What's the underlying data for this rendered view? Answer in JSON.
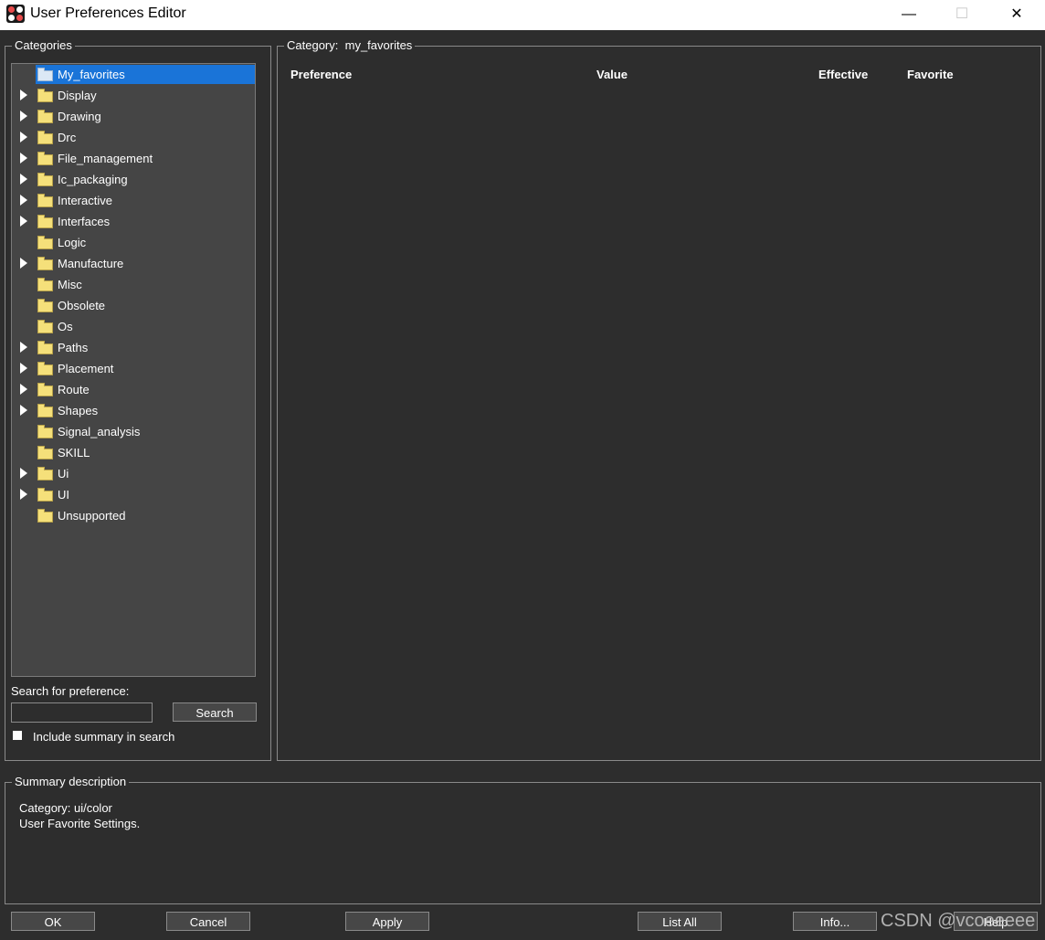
{
  "window": {
    "title": "User Preferences Editor",
    "minimize_glyph": "—",
    "maximize_glyph": "☐",
    "close_glyph": "✕"
  },
  "categories": {
    "group_label": "Categories",
    "items": [
      {
        "label": "My_favorites",
        "expandable": false,
        "selected": true
      },
      {
        "label": "Display",
        "expandable": true
      },
      {
        "label": "Drawing",
        "expandable": true
      },
      {
        "label": "Drc",
        "expandable": true
      },
      {
        "label": "File_management",
        "expandable": true
      },
      {
        "label": "Ic_packaging",
        "expandable": true
      },
      {
        "label": "Interactive",
        "expandable": true
      },
      {
        "label": "Interfaces",
        "expandable": true
      },
      {
        "label": "Logic",
        "expandable": false
      },
      {
        "label": "Manufacture",
        "expandable": true
      },
      {
        "label": "Misc",
        "expandable": false
      },
      {
        "label": "Obsolete",
        "expandable": false
      },
      {
        "label": "Os",
        "expandable": false
      },
      {
        "label": "Paths",
        "expandable": true
      },
      {
        "label": "Placement",
        "expandable": true
      },
      {
        "label": "Route",
        "expandable": true
      },
      {
        "label": "Shapes",
        "expandable": true
      },
      {
        "label": "Signal_analysis",
        "expandable": false
      },
      {
        "label": "SKILL",
        "expandable": false
      },
      {
        "label": "Ui",
        "expandable": true
      },
      {
        "label": "UI",
        "expandable": true
      },
      {
        "label": "Unsupported",
        "expandable": false
      }
    ],
    "search_label": "Search for preference:",
    "search_value": "",
    "search_button": "Search",
    "include_summary_label": "Include summary in search",
    "include_summary_checked": false
  },
  "category_panel": {
    "label_prefix": "Category:",
    "label_value": "my_favorites",
    "columns": [
      "Preference",
      "Value",
      "Effective",
      "Favorite"
    ]
  },
  "summary": {
    "group_label": "Summary description",
    "lines": [
      "Category: ui/color",
      "User Favorite Settings."
    ]
  },
  "buttons": {
    "ok": "OK",
    "cancel": "Cancel",
    "apply": "Apply",
    "list_all": "List All",
    "info": "Info...",
    "help": "Help"
  },
  "watermark": "CSDN @vcoeeeee",
  "colors": {
    "background": "#2d2d2d",
    "tree_background": "#454545",
    "selection": "#1a74d8",
    "folder": "#f5e07a"
  }
}
